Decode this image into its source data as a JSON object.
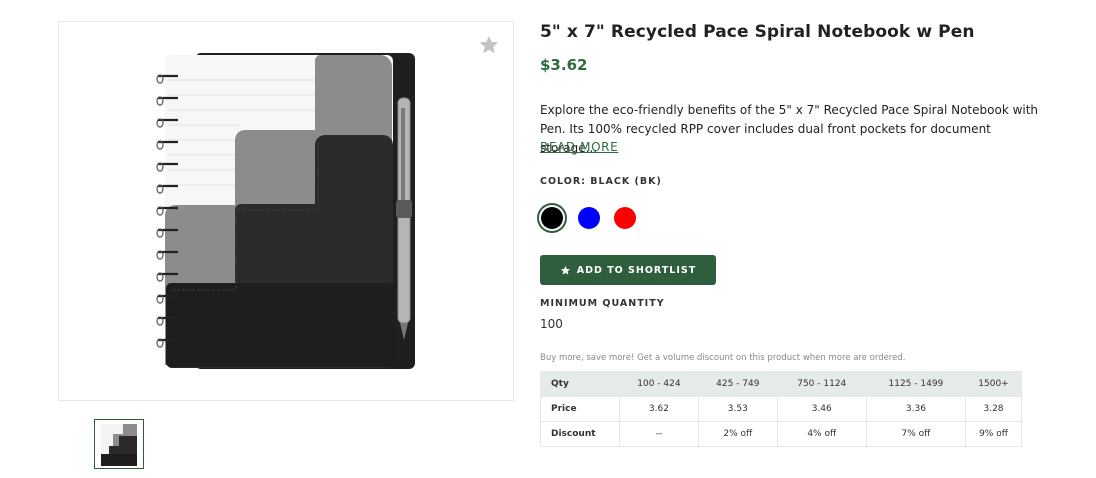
{
  "product": {
    "title": "5\" x 7\" Recycled Pace Spiral Notebook w Pen",
    "price": "$3.62",
    "description": "Explore the eco-friendly benefits of the 5\" x 7\" Recycled Pace Spiral Notebook with Pen. Its 100% recycled RPP cover includes dual front pockets for document storage...",
    "read_more": "READ MORE",
    "favorite_icon": "star-icon"
  },
  "color": {
    "label": "COLOR: BLACK (BK)",
    "selected": "black",
    "options": [
      {
        "name": "black",
        "hex": "#000000"
      },
      {
        "name": "blue",
        "hex": "#0000ff"
      },
      {
        "name": "red",
        "hex": "#ff0000"
      }
    ]
  },
  "shortlist": {
    "label": "ADD TO SHORTLIST",
    "icon": "star-icon"
  },
  "minimum": {
    "label": "MINIMUM QUANTITY",
    "value": "100"
  },
  "volume": {
    "note": "Buy more, save more! Get a volume discount on this product when more are ordered.",
    "header": [
      "Qty",
      "100 - 424",
      "425 - 749",
      "750 - 1124",
      "1125 - 1499",
      "1500+"
    ],
    "price_row": [
      "Price",
      "3.62",
      "3.53",
      "3.46",
      "3.36",
      "3.28"
    ],
    "discount_row": [
      "Discount",
      "--",
      "2% off",
      "4% off",
      "7% off",
      "9% off"
    ]
  },
  "colors": {
    "accent": "#2e5e3b",
    "price": "#2e6b3f",
    "table_header": "#e5ebe7"
  }
}
